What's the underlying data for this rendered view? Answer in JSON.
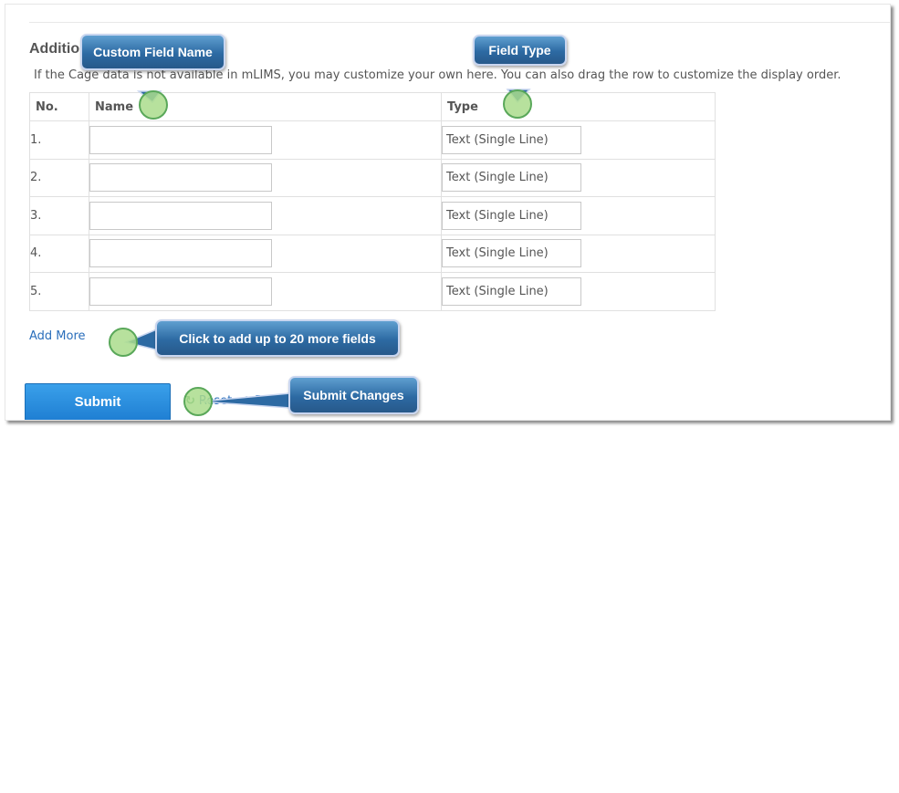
{
  "section": {
    "title": "Additional Information",
    "hint": "If the Cage data is not available in mLIMS, you may customize your own here. You can also drag the row to customize the display order."
  },
  "table": {
    "headers": {
      "no": "No.",
      "name": "Name",
      "type": "Type"
    },
    "rows": [
      {
        "no": "1.",
        "name": "",
        "type": "Text (Single Line)"
      },
      {
        "no": "2.",
        "name": "",
        "type": "Text (Single Line)"
      },
      {
        "no": "3.",
        "name": "",
        "type": "Text (Single Line)"
      },
      {
        "no": "4.",
        "name": "",
        "type": "Text (Single Line)"
      },
      {
        "no": "5.",
        "name": "",
        "type": "Text (Single Line)"
      }
    ]
  },
  "actions": {
    "add_more": "Add More",
    "submit": "Submit",
    "reset": "Reset",
    "return": "Return to System Settings"
  },
  "icons": {
    "reset": "refresh-icon",
    "return": "undo-arrow-icon"
  },
  "callouts": {
    "name": "Custom Field Name",
    "type": "Field Type",
    "add_more": "Click to add up to 20 more fields",
    "submit": "Submit Changes"
  },
  "colors": {
    "link": "#2a6ebb",
    "button": "#2a8fe0",
    "callout": "#2d6aa3",
    "marker": "#aadc8c"
  }
}
